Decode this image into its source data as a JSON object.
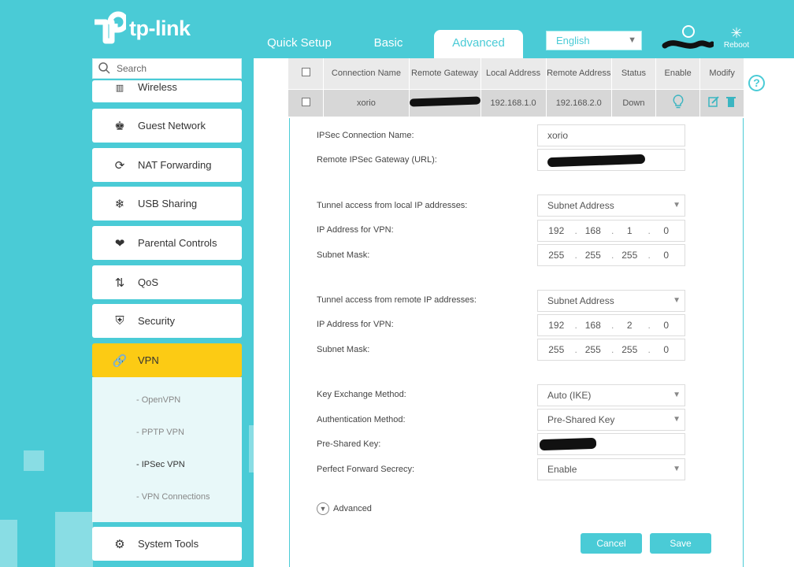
{
  "brand": {
    "logo_text": "tp-link"
  },
  "header": {
    "tabs": [
      {
        "label": "Quick Setup"
      },
      {
        "label": "Basic"
      },
      {
        "label": "Advanced"
      }
    ],
    "language": "English",
    "reboot_label": "Reboot"
  },
  "sidebar": {
    "search_placeholder": "Search",
    "items": [
      {
        "label": "Wireless",
        "icon": "wifi-icon"
      },
      {
        "label": "Guest Network",
        "icon": "guest-icon"
      },
      {
        "label": "NAT Forwarding",
        "icon": "nat-icon"
      },
      {
        "label": "USB Sharing",
        "icon": "usb-icon"
      },
      {
        "label": "Parental Controls",
        "icon": "heart-icon"
      },
      {
        "label": "QoS",
        "icon": "qos-icon"
      },
      {
        "label": "Security",
        "icon": "shield-icon"
      },
      {
        "label": "VPN",
        "icon": "link-icon"
      },
      {
        "label": "System Tools",
        "icon": "gear-icon"
      }
    ],
    "vpn_sub": [
      {
        "label": "- OpenVPN"
      },
      {
        "label": "- PPTP VPN"
      },
      {
        "label": "- IPSec VPN"
      },
      {
        "label": "- VPN Connections"
      }
    ]
  },
  "table": {
    "headers": [
      "Connection Name",
      "Remote Gateway",
      "Local Address",
      "Remote Address",
      "Status",
      "Enable",
      "Modify"
    ],
    "row": {
      "name": "xorio",
      "local": "192.168.1.0",
      "remote": "192.168.2.0",
      "status": "Down"
    }
  },
  "form": {
    "conn_name_label": "IPSec Connection Name:",
    "conn_name_value": "xorio",
    "gateway_label": "Remote IPSec Gateway (URL):",
    "local_access_label": "Tunnel access from local IP addresses:",
    "local_access_value": "Subnet Address",
    "local_ip_label": "IP Address for VPN:",
    "local_ip": [
      "192",
      "168",
      "1",
      "0"
    ],
    "local_mask_label": "Subnet Mask:",
    "local_mask": [
      "255",
      "255",
      "255",
      "0"
    ],
    "remote_access_label": "Tunnel access from remote IP addresses:",
    "remote_access_value": "Subnet Address",
    "remote_ip_label": "IP Address for VPN:",
    "remote_ip": [
      "192",
      "168",
      "2",
      "0"
    ],
    "remote_mask_label": "Subnet Mask:",
    "remote_mask": [
      "255",
      "255",
      "255",
      "0"
    ],
    "key_exchange_label": "Key Exchange Method:",
    "key_exchange_value": "Auto (IKE)",
    "auth_label": "Authentication Method:",
    "auth_value": "Pre-Shared Key",
    "psk_label": "Pre-Shared Key:",
    "pfs_label": "Perfect Forward Secrecy:",
    "pfs_value": "Enable",
    "advanced_label": "Advanced"
  },
  "buttons": {
    "cancel": "Cancel",
    "save": "Save"
  },
  "colors": {
    "accent": "#4acbd6",
    "active_menu": "#fccb14"
  }
}
